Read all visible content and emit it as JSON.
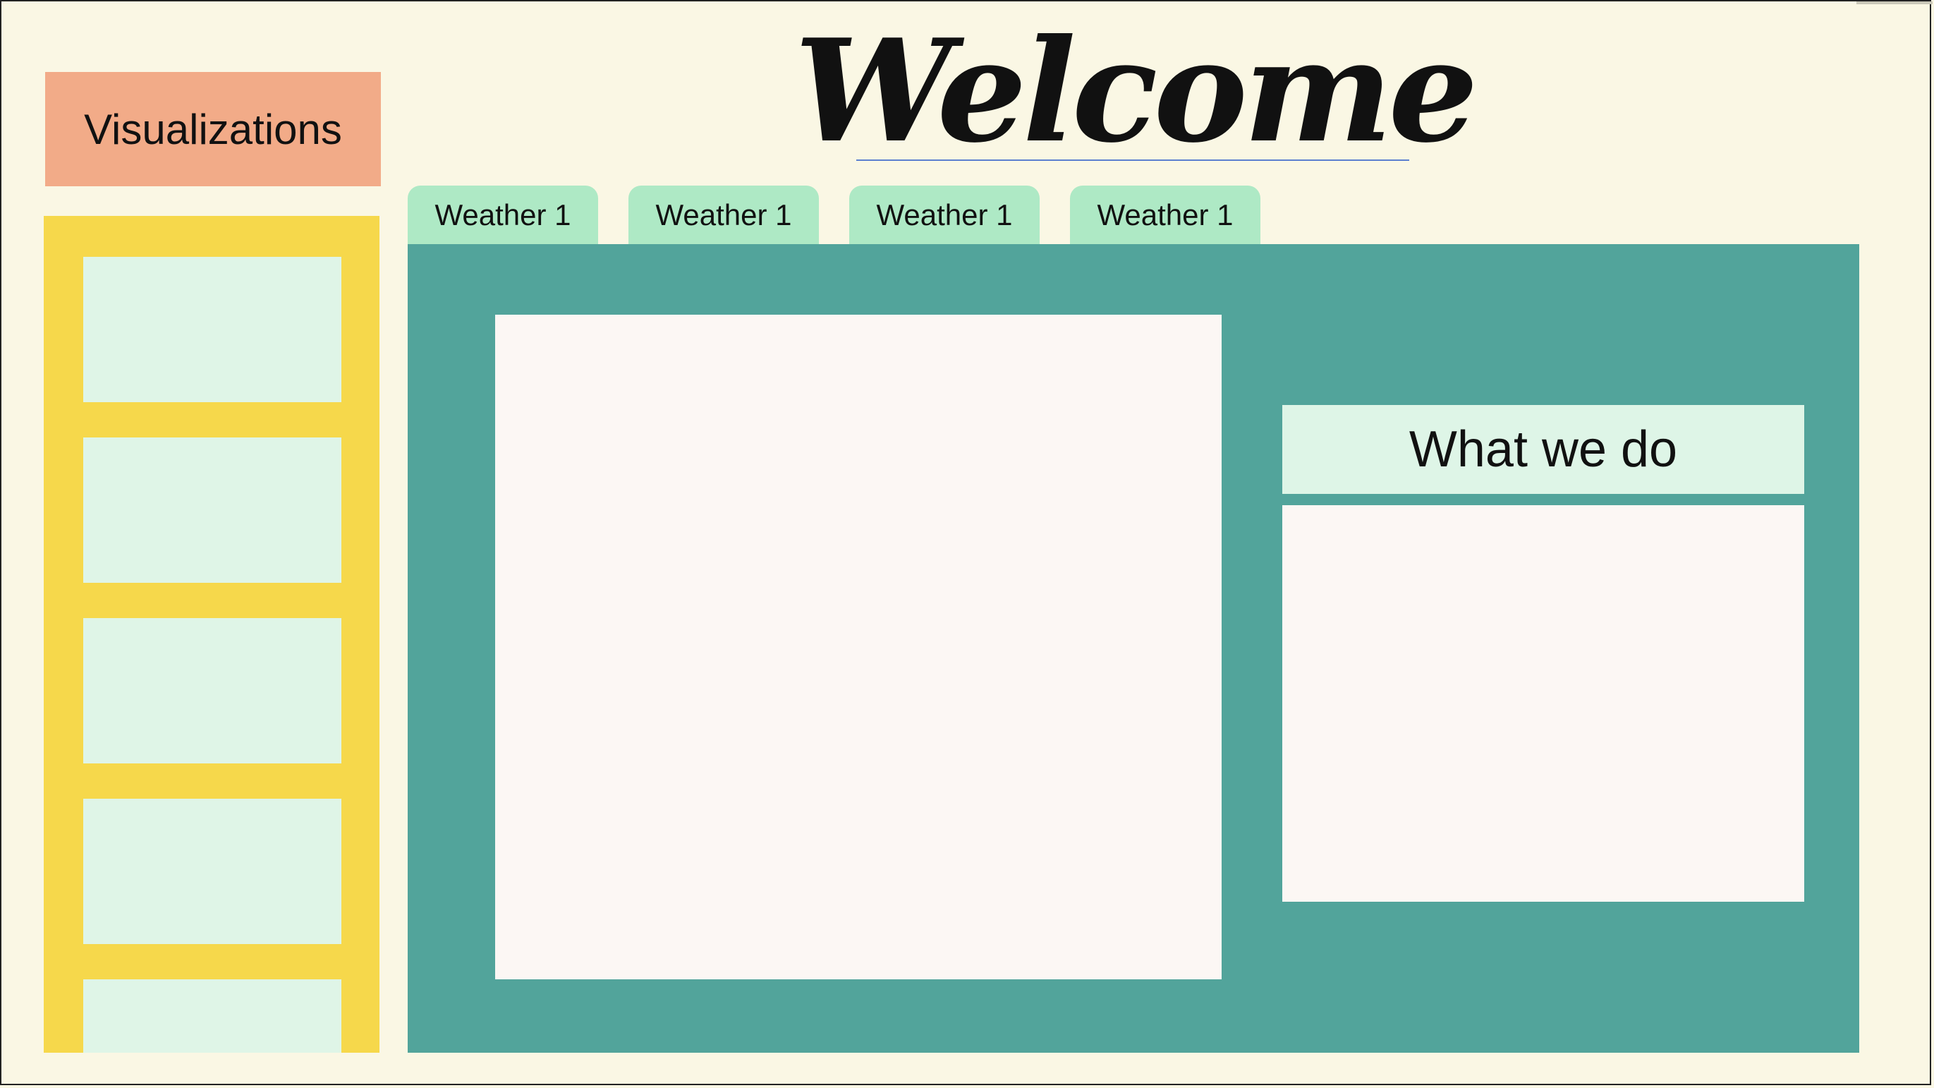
{
  "title": "Welcome",
  "sidebar": {
    "header_label": "Visualizations",
    "thumbnails": 5
  },
  "tabs": [
    {
      "label": "Weather 1"
    },
    {
      "label": "Weather 1"
    },
    {
      "label": "Weather 1"
    },
    {
      "label": "Weather 1"
    }
  ],
  "main": {
    "what_we_do_label": "What we do"
  },
  "colors": {
    "background": "#faf7e4",
    "viz_header": "#f2ab88",
    "sidebar": "#f6d84b",
    "thumbnail": "#dff5e7",
    "tab": "#aee9c5",
    "main_panel": "#52a49b",
    "content_box": "#fcf7f4"
  }
}
